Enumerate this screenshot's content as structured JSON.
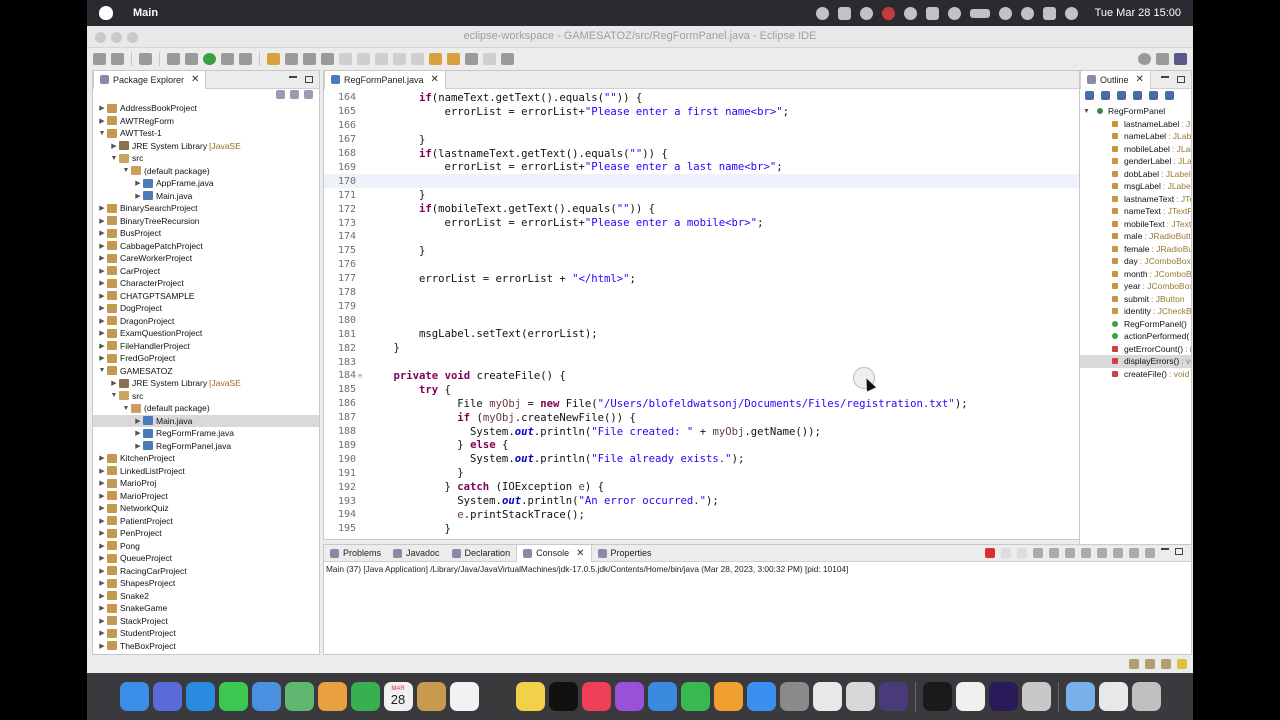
{
  "menubar": {
    "app_name": "Main",
    "clock": "Tue Mar 28  15:00"
  },
  "window": {
    "title": "eclipse-workspace - GAMESATOZ/src/RegFormPanel.java - Eclipse IDE"
  },
  "package_explorer": {
    "tab_label": "Package Explorer",
    "items": [
      {
        "label": "AddressBookProject",
        "indent": 0,
        "arrow": "▶",
        "kind": "proj"
      },
      {
        "label": "AWTRegForm",
        "indent": 0,
        "arrow": "▶",
        "kind": "proj"
      },
      {
        "label": "AWTTest-1",
        "indent": 0,
        "arrow": "▼",
        "kind": "proj"
      },
      {
        "label": "JRE System Library",
        "suffix": "[JavaSE",
        "indent": 1,
        "arrow": "▶",
        "kind": "lib"
      },
      {
        "label": "src",
        "indent": 1,
        "arrow": "▼",
        "kind": "src"
      },
      {
        "label": "(default package)",
        "indent": 2,
        "arrow": "▼",
        "kind": "pkgi"
      },
      {
        "label": "AppFrame.java",
        "indent": 3,
        "arrow": "▶",
        "kind": "java"
      },
      {
        "label": "Main.java",
        "indent": 3,
        "arrow": "▶",
        "kind": "java"
      },
      {
        "label": "BinarySearchProject",
        "indent": 0,
        "arrow": "▶",
        "kind": "proj"
      },
      {
        "label": "BinaryTreeRecursion",
        "indent": 0,
        "arrow": "▶",
        "kind": "proj"
      },
      {
        "label": "BusProject",
        "indent": 0,
        "arrow": "▶",
        "kind": "proj"
      },
      {
        "label": "CabbagePatchProject",
        "indent": 0,
        "arrow": "▶",
        "kind": "proj"
      },
      {
        "label": "CareWorkerProject",
        "indent": 0,
        "arrow": "▶",
        "kind": "proj"
      },
      {
        "label": "CarProject",
        "indent": 0,
        "arrow": "▶",
        "kind": "proj"
      },
      {
        "label": "CharacterProject",
        "indent": 0,
        "arrow": "▶",
        "kind": "proj"
      },
      {
        "label": "CHATGPTSAMPLE",
        "indent": 0,
        "arrow": "▶",
        "kind": "proj"
      },
      {
        "label": "DogProject",
        "indent": 0,
        "arrow": "▶",
        "kind": "proj"
      },
      {
        "label": "DragonProject",
        "indent": 0,
        "arrow": "▶",
        "kind": "proj"
      },
      {
        "label": "ExamQuestionProject",
        "indent": 0,
        "arrow": "▶",
        "kind": "proj"
      },
      {
        "label": "FileHandlerProject",
        "indent": 0,
        "arrow": "▶",
        "kind": "proj"
      },
      {
        "label": "FredGoProject",
        "indent": 0,
        "arrow": "▶",
        "kind": "proj"
      },
      {
        "label": "GAMESATOZ",
        "indent": 0,
        "arrow": "▼",
        "kind": "proj"
      },
      {
        "label": "JRE System Library",
        "suffix": "[JavaSE",
        "indent": 1,
        "arrow": "▶",
        "kind": "lib"
      },
      {
        "label": "src",
        "indent": 1,
        "arrow": "▼",
        "kind": "src"
      },
      {
        "label": "(default package)",
        "indent": 2,
        "arrow": "▼",
        "kind": "pkgi"
      },
      {
        "label": "Main.java",
        "indent": 3,
        "arrow": "▶",
        "kind": "java",
        "selected": true
      },
      {
        "label": "RegFormFrame.java",
        "indent": 3,
        "arrow": "▶",
        "kind": "java"
      },
      {
        "label": "RegFormPanel.java",
        "indent": 3,
        "arrow": "▶",
        "kind": "java"
      },
      {
        "label": "KitchenProject",
        "indent": 0,
        "arrow": "▶",
        "kind": "proj"
      },
      {
        "label": "LinkedListProject",
        "indent": 0,
        "arrow": "▶",
        "kind": "proj"
      },
      {
        "label": "MarioProj",
        "indent": 0,
        "arrow": "▶",
        "kind": "proj"
      },
      {
        "label": "MarioProject",
        "indent": 0,
        "arrow": "▶",
        "kind": "proj"
      },
      {
        "label": "NetworkQuiz",
        "indent": 0,
        "arrow": "▶",
        "kind": "proj"
      },
      {
        "label": "PatientProject",
        "indent": 0,
        "arrow": "▶",
        "kind": "proj"
      },
      {
        "label": "PenProject",
        "indent": 0,
        "arrow": "▶",
        "kind": "proj"
      },
      {
        "label": "Pong",
        "indent": 0,
        "arrow": "▶",
        "kind": "proj"
      },
      {
        "label": "QueueProject",
        "indent": 0,
        "arrow": "▶",
        "kind": "proj"
      },
      {
        "label": "RacingCarProject",
        "indent": 0,
        "arrow": "▶",
        "kind": "proj"
      },
      {
        "label": "ShapesProject",
        "indent": 0,
        "arrow": "▶",
        "kind": "proj"
      },
      {
        "label": "Snake2",
        "indent": 0,
        "arrow": "▶",
        "kind": "proj"
      },
      {
        "label": "SnakeGame",
        "indent": 0,
        "arrow": "▶",
        "kind": "proj"
      },
      {
        "label": "StackProject",
        "indent": 0,
        "arrow": "▶",
        "kind": "proj"
      },
      {
        "label": "StudentProject",
        "indent": 0,
        "arrow": "▶",
        "kind": "proj"
      },
      {
        "label": "TheBoxProject",
        "indent": 0,
        "arrow": "▶",
        "kind": "proj"
      }
    ]
  },
  "editor": {
    "tab_label": "RegFormPanel.java",
    "current_line": "170",
    "lines": [
      {
        "n": "164",
        "html": "        <span class='kw'>if</span>(<span class='fld2'>nameText</span>.getText().equals(<span class='str'>\"\"</span>)) {"
      },
      {
        "n": "165",
        "html": "            errorList = errorList+<span class='str'>\"Please enter a first name&lt;br&gt;\"</span>;"
      },
      {
        "n": "166",
        "html": ""
      },
      {
        "n": "167",
        "html": "        }"
      },
      {
        "n": "168",
        "html": "        <span class='kw'>if</span>(lastnameText.getText().equals(<span class='str'>\"\"</span>)) {"
      },
      {
        "n": "169",
        "html": "            errorList = errorList+<span class='str'>\"Please enter a last name&lt;br&gt;\"</span>;"
      },
      {
        "n": "170",
        "html": ""
      },
      {
        "n": "171",
        "html": "        }"
      },
      {
        "n": "172",
        "html": "        <span class='kw'>if</span>(mobileText.getText().equals(<span class='str'>\"\"</span>)) {"
      },
      {
        "n": "173",
        "html": "            errorList = errorList+<span class='str'>\"Please enter a mobile&lt;br&gt;\"</span>;"
      },
      {
        "n": "174",
        "html": ""
      },
      {
        "n": "175",
        "html": "        }"
      },
      {
        "n": "176",
        "html": ""
      },
      {
        "n": "177",
        "html": "        errorList = errorList + <span class='str'>\"&lt;/html&gt;\"</span>;"
      },
      {
        "n": "178",
        "html": ""
      },
      {
        "n": "179",
        "html": ""
      },
      {
        "n": "180",
        "html": ""
      },
      {
        "n": "181",
        "html": "        msgLabel.setText(errorList);"
      },
      {
        "n": "182",
        "html": "    }"
      },
      {
        "n": "183",
        "html": ""
      },
      {
        "n": "184",
        "fold": "⊖",
        "html": "    <span class='kw'>private</span> <span class='kw'>void</span> createFile() {"
      },
      {
        "n": "185",
        "html": "        <span class='kw'>try</span> {"
      },
      {
        "n": "186",
        "html": "              File <span class='var'>myObj</span> = <span class='kw'>new</span> File(<span class='str'>\"/Users/blofeldwatsonj/Documents/Files/registration.txt\"</span>);"
      },
      {
        "n": "187",
        "html": "              <span class='kw'>if</span> (<span class='var'>myObj</span>.createNewFile()) {"
      },
      {
        "n": "188",
        "html": "                System.<span class='fld'>out</span>.println(<span class='str'>\"File created: \"</span> + <span class='var'>myObj</span>.getName());"
      },
      {
        "n": "189",
        "html": "              } <span class='kw'>else</span> {"
      },
      {
        "n": "190",
        "html": "                System.<span class='fld'>out</span>.println(<span class='str'>\"File already exists.\"</span>);"
      },
      {
        "n": "191",
        "html": "              }"
      },
      {
        "n": "192",
        "html": "            } <span class='kw'>catch</span> (IOException <span class='var'>e</span>) {"
      },
      {
        "n": "193",
        "html": "              System.<span class='fld'>out</span>.println(<span class='str'>\"An error occurred.\"</span>);"
      },
      {
        "n": "194",
        "html": "              <span class='var'>e</span>.printStackTrace();"
      },
      {
        "n": "195",
        "html": "            }"
      }
    ]
  },
  "outline": {
    "tab_label": "Outline",
    "class_name": "RegFormPanel",
    "items": [
      {
        "name": "lastnameLabel",
        "type": ": JLabel",
        "kind": "field"
      },
      {
        "name": "nameLabel",
        "type": ": JLabel",
        "kind": "field"
      },
      {
        "name": "mobileLabel",
        "type": ": JLabel",
        "kind": "field"
      },
      {
        "name": "genderLabel",
        "type": ": JLabel",
        "kind": "field"
      },
      {
        "name": "dobLabel",
        "type": ": JLabel",
        "kind": "field"
      },
      {
        "name": "msgLabel",
        "type": ": JLabel",
        "kind": "field"
      },
      {
        "name": "lastnameText",
        "type": ": JTextField",
        "kind": "field"
      },
      {
        "name": "nameText",
        "type": ": JTextField",
        "kind": "field"
      },
      {
        "name": "mobileText",
        "type": ": JTextField",
        "kind": "field"
      },
      {
        "name": "male",
        "type": ": JRadioButton",
        "kind": "field"
      },
      {
        "name": "female",
        "type": ": JRadioButton",
        "kind": "field"
      },
      {
        "name": "day",
        "type": ": JComboBox",
        "kind": "field"
      },
      {
        "name": "month",
        "type": ": JComboBox",
        "kind": "field"
      },
      {
        "name": "year",
        "type": ": JComboBox",
        "kind": "field"
      },
      {
        "name": "submit",
        "type": ": JButton",
        "kind": "field"
      },
      {
        "name": "identity",
        "type": ": JCheckBox",
        "kind": "field"
      },
      {
        "name": "RegFormPanel()",
        "type": "",
        "kind": "pub"
      },
      {
        "name": "actionPerformed(",
        "type": "",
        "kind": "pub"
      },
      {
        "name": "getErrorCount()",
        "type": ": int",
        "kind": "meth"
      },
      {
        "name": "displayErrors()",
        "type": ": void",
        "kind": "meth",
        "selected": true
      },
      {
        "name": "createFile()",
        "type": ": void",
        "kind": "meth"
      }
    ]
  },
  "console": {
    "tabs": [
      "Problems",
      "Javadoc",
      "Declaration",
      "Console",
      "Properties"
    ],
    "active_tab": "Console",
    "info": "Main (37) [Java Application] /Library/Java/JavaVirtualMachines/jdk-17.0.5.jdk/Contents/Home/bin/java  (Mar 28, 2023, 3:00:32 PM) [pid: 10104]"
  },
  "dock": {
    "calendar_month": "MAR",
    "calendar_day": "28",
    "apps": [
      {
        "name": "finder",
        "color": "#3a8ee8"
      },
      {
        "name": "launchpad",
        "color": "#5a6ad8"
      },
      {
        "name": "safari",
        "color": "#2a8ae0"
      },
      {
        "name": "messages",
        "color": "#3ac850"
      },
      {
        "name": "mail",
        "color": "#4a90e0"
      },
      {
        "name": "maps",
        "color": "#60b870"
      },
      {
        "name": "photos",
        "color": "#e8a040"
      },
      {
        "name": "facetime",
        "color": "#38b050"
      },
      {
        "name": "calendar",
        "color": "#f0f0f0"
      },
      {
        "name": "notes-brown",
        "color": "#c89a50"
      },
      {
        "name": "reminders",
        "color": "#f2f2f2"
      },
      {
        "name": "sublime",
        "color": "#3a3a3a"
      },
      {
        "name": "notes",
        "color": "#f2d04a"
      },
      {
        "name": "apple-tv",
        "color": "#111111"
      },
      {
        "name": "music",
        "color": "#f04058"
      },
      {
        "name": "podcasts",
        "color": "#9a50d8"
      },
      {
        "name": "keynote",
        "color": "#3a8ae0"
      },
      {
        "name": "numbers",
        "color": "#3ab850"
      },
      {
        "name": "pages",
        "color": "#f0a030"
      },
      {
        "name": "app-store",
        "color": "#3a90f0"
      },
      {
        "name": "settings",
        "color": "#8a8a8a"
      },
      {
        "name": "chrome",
        "color": "#e8e8e8"
      },
      {
        "name": "preview",
        "color": "#d8d8d8"
      },
      {
        "name": "eclipse",
        "color": "#4a3a7a"
      },
      {
        "name": "terminal",
        "color": "#1a1a1a"
      },
      {
        "name": "textedit",
        "color": "#f0f0f0"
      },
      {
        "name": "premiere",
        "color": "#2a1a5a"
      },
      {
        "name": "scripts",
        "color": "#c8c8c8"
      },
      {
        "name": "folder",
        "color": "#7ab0e8"
      },
      {
        "name": "documents",
        "color": "#e8e8e8"
      },
      {
        "name": "trash",
        "color": "#c0c0c0"
      }
    ]
  }
}
